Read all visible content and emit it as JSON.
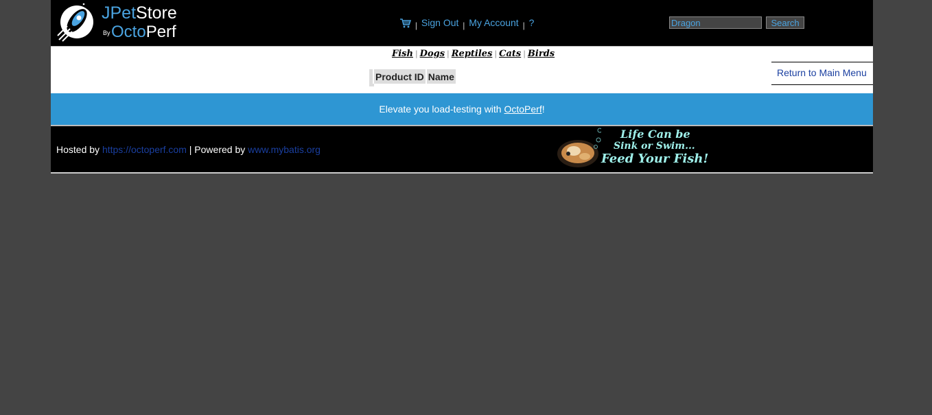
{
  "header": {
    "logo": {
      "line1_prefix": "JPet",
      "line1_suffix": "Store",
      "by": "By",
      "line2_prefix": "Octo",
      "line2_suffix": "Perf"
    },
    "menu": {
      "cart_icon": "shopping-cart-icon",
      "sign_out": "Sign Out",
      "my_account": "My Account",
      "help": "?"
    },
    "search": {
      "value": "Dragon",
      "button_label": "Search"
    }
  },
  "quicklinks": [
    "Fish",
    "Dogs",
    "Reptiles",
    "Cats",
    "Birds"
  ],
  "content": {
    "return_link": "Return to Main Menu",
    "table_headers": [
      "",
      "Product ID",
      "Name"
    ]
  },
  "banner": {
    "text_before": "Elevate you load-testing with ",
    "link": "OctoPerf",
    "text_after": "!"
  },
  "footer": {
    "hosted_by": "Hosted by ",
    "hosted_link": "https://octoperf.com",
    "powered_by": " | Powered by ",
    "powered_link": "www.mybatis.org",
    "ad": {
      "line1": "Life Can be",
      "line2": "Sink or Swim...",
      "line3": "Feed Your Fish!"
    }
  },
  "colors": {
    "page_bg": "#444444",
    "header_bg": "#000000",
    "accent_blue": "#4aa3e0",
    "banner_blue": "#2e96d3",
    "link_dark_blue": "#1a3fa0",
    "ad_text": "#9ff0ea"
  }
}
